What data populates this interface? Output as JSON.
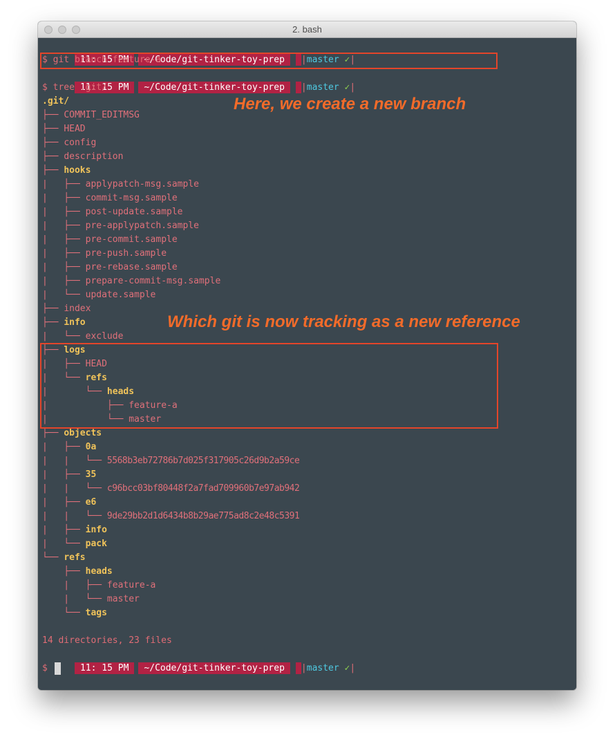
{
  "window": {
    "title": "2. bash"
  },
  "prompt": {
    "time": "11: 15 PM",
    "path": "~/Code/git-tinker-toy-prep",
    "branch": "master",
    "clean": "✓"
  },
  "commands": {
    "branch": "$ git branch feature-a",
    "tree": "$ tree .git/",
    "last": "$"
  },
  "tree": [
    {
      "prefix": "",
      "name": ".git/",
      "kind": "root"
    },
    {
      "prefix": "├── ",
      "name": "COMMIT_EDITMSG",
      "kind": "file"
    },
    {
      "prefix": "├── ",
      "name": "HEAD",
      "kind": "file"
    },
    {
      "prefix": "├── ",
      "name": "config",
      "kind": "file"
    },
    {
      "prefix": "├── ",
      "name": "description",
      "kind": "file"
    },
    {
      "prefix": "├── ",
      "name": "hooks",
      "kind": "dir"
    },
    {
      "prefix": "|   ├── ",
      "name": "applypatch-msg.sample",
      "kind": "file"
    },
    {
      "prefix": "|   ├── ",
      "name": "commit-msg.sample",
      "kind": "file"
    },
    {
      "prefix": "|   ├── ",
      "name": "post-update.sample",
      "kind": "file"
    },
    {
      "prefix": "|   ├── ",
      "name": "pre-applypatch.sample",
      "kind": "file"
    },
    {
      "prefix": "|   ├── ",
      "name": "pre-commit.sample",
      "kind": "file"
    },
    {
      "prefix": "|   ├── ",
      "name": "pre-push.sample",
      "kind": "file"
    },
    {
      "prefix": "|   ├── ",
      "name": "pre-rebase.sample",
      "kind": "file"
    },
    {
      "prefix": "|   ├── ",
      "name": "prepare-commit-msg.sample",
      "kind": "file"
    },
    {
      "prefix": "|   └── ",
      "name": "update.sample",
      "kind": "file"
    },
    {
      "prefix": "├── ",
      "name": "index",
      "kind": "file"
    },
    {
      "prefix": "├── ",
      "name": "info",
      "kind": "dir"
    },
    {
      "prefix": "|   └── ",
      "name": "exclude",
      "kind": "file"
    },
    {
      "prefix": "├── ",
      "name": "logs",
      "kind": "dir"
    },
    {
      "prefix": "|   ├── ",
      "name": "HEAD",
      "kind": "file"
    },
    {
      "prefix": "|   └── ",
      "name": "refs",
      "kind": "dir"
    },
    {
      "prefix": "|       └── ",
      "name": "heads",
      "kind": "dir"
    },
    {
      "prefix": "|           ├── ",
      "name": "feature-a",
      "kind": "file"
    },
    {
      "prefix": "|           └── ",
      "name": "master",
      "kind": "file"
    },
    {
      "prefix": "├── ",
      "name": "objects",
      "kind": "dir"
    },
    {
      "prefix": "|   ├── ",
      "name": "0a",
      "kind": "dir"
    },
    {
      "prefix": "|   |   └── ",
      "name": "5568b3eb72786b7d025f317905c26d9b2a59ce",
      "kind": "hash"
    },
    {
      "prefix": "|   ├── ",
      "name": "35",
      "kind": "dir"
    },
    {
      "prefix": "|   |   └── ",
      "name": "c96bcc03bf80448f2a7fad709960b7e97ab942",
      "kind": "hash"
    },
    {
      "prefix": "|   ├── ",
      "name": "e6",
      "kind": "dir"
    },
    {
      "prefix": "|   |   └── ",
      "name": "9de29bb2d1d6434b8b29ae775ad8c2e48c5391",
      "kind": "hash"
    },
    {
      "prefix": "|   ├── ",
      "name": "info",
      "kind": "dir"
    },
    {
      "prefix": "|   └── ",
      "name": "pack",
      "kind": "dir"
    },
    {
      "prefix": "└── ",
      "name": "refs",
      "kind": "dir"
    },
    {
      "prefix": "    ├── ",
      "name": "heads",
      "kind": "dir"
    },
    {
      "prefix": "    |   ├── ",
      "name": "feature-a",
      "kind": "file"
    },
    {
      "prefix": "    |   └── ",
      "name": "master",
      "kind": "file"
    },
    {
      "prefix": "    └── ",
      "name": "tags",
      "kind": "dir"
    }
  ],
  "summary": "14 directories, 23 files",
  "annotations": {
    "new_branch": "Here, we create a new branch",
    "new_reference": "Which git is now tracking as a new reference"
  },
  "colors": {
    "terminal_bg": "#3b474f",
    "prompt_bg": "#b22244",
    "annotation": "#f26b2a",
    "dir": "#f0c35a",
    "file": "#e06c75",
    "branch": "#4ec9e1"
  }
}
